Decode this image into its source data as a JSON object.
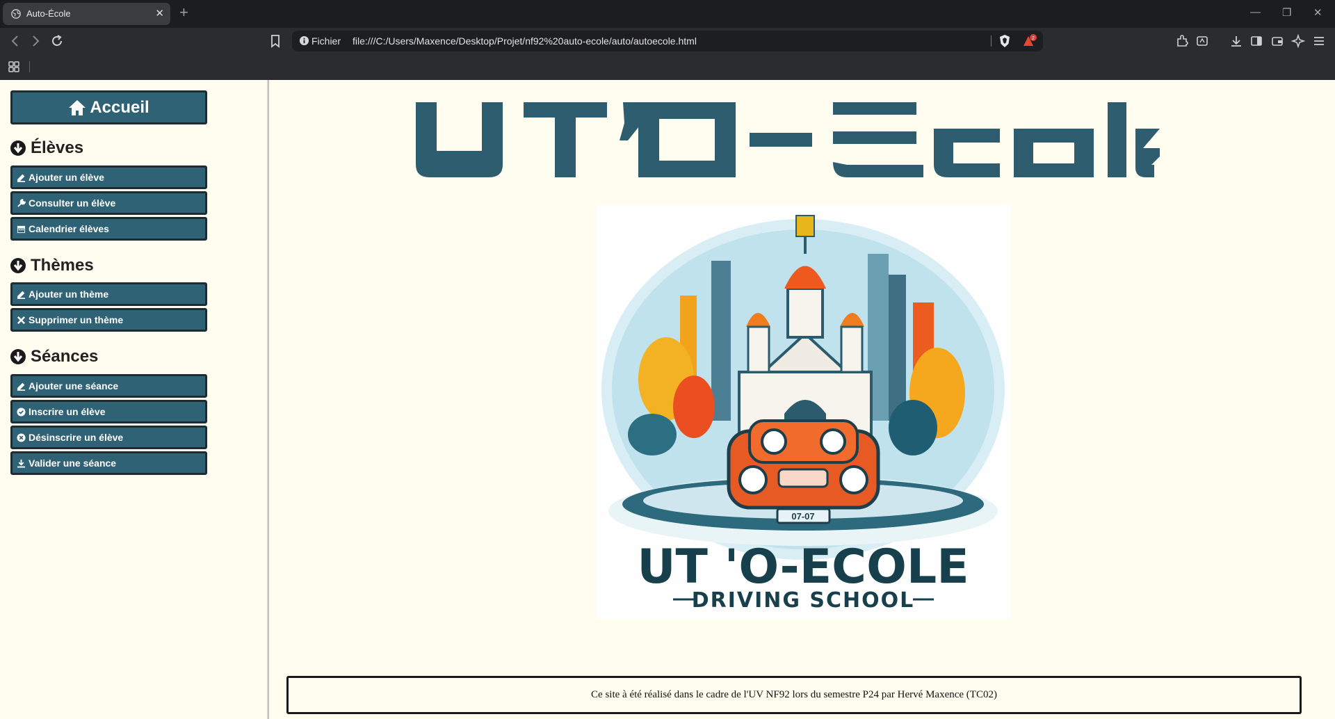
{
  "browser": {
    "tab_title": "Auto-École",
    "new_tab_glyph": "+",
    "url_scheme_label": "Fichier",
    "url": "file:///C:/Users/Maxence/Desktop/Projet/nf92%20auto-ecole/auto/autoecole.html",
    "rewards_badge": "2"
  },
  "sidebar": {
    "home_label": "Accueil",
    "sections": [
      {
        "title": "Élèves",
        "buttons": [
          {
            "label": "Ajouter un élève",
            "icon": "pencil-icon"
          },
          {
            "label": "Consulter un élève",
            "icon": "wrench-icon"
          },
          {
            "label": "Calendrier élèves",
            "icon": "calendar-icon"
          }
        ]
      },
      {
        "title": "Thèmes",
        "buttons": [
          {
            "label": "Ajouter un thème",
            "icon": "pencil-icon"
          },
          {
            "label": "Supprimer un thème",
            "icon": "x-mark-icon"
          }
        ]
      },
      {
        "title": "Séances",
        "buttons": [
          {
            "label": "Ajouter une séance",
            "icon": "pencil-icon"
          },
          {
            "label": "Inscrire un élève",
            "icon": "check-circle-icon"
          },
          {
            "label": "Désinscrire un élève",
            "icon": "x-circle-icon"
          },
          {
            "label": "Valider une séance",
            "icon": "download-icon"
          }
        ]
      }
    ]
  },
  "main": {
    "banner_alt": "UT'O-Ecole",
    "logo": {
      "plate": "07-07",
      "title": "UT 'O-ECOLE",
      "subtitle": "DRIVING SCHOOL"
    },
    "footer_text": "Ce site à été réalisé dans le cadre de l'UV NF92 lors du semestre P24 par Hervé Maxence (TC02)"
  },
  "colors": {
    "accent": "#2f6275",
    "page_bg": "#fefdf0",
    "logo_text": "#173f4c"
  }
}
